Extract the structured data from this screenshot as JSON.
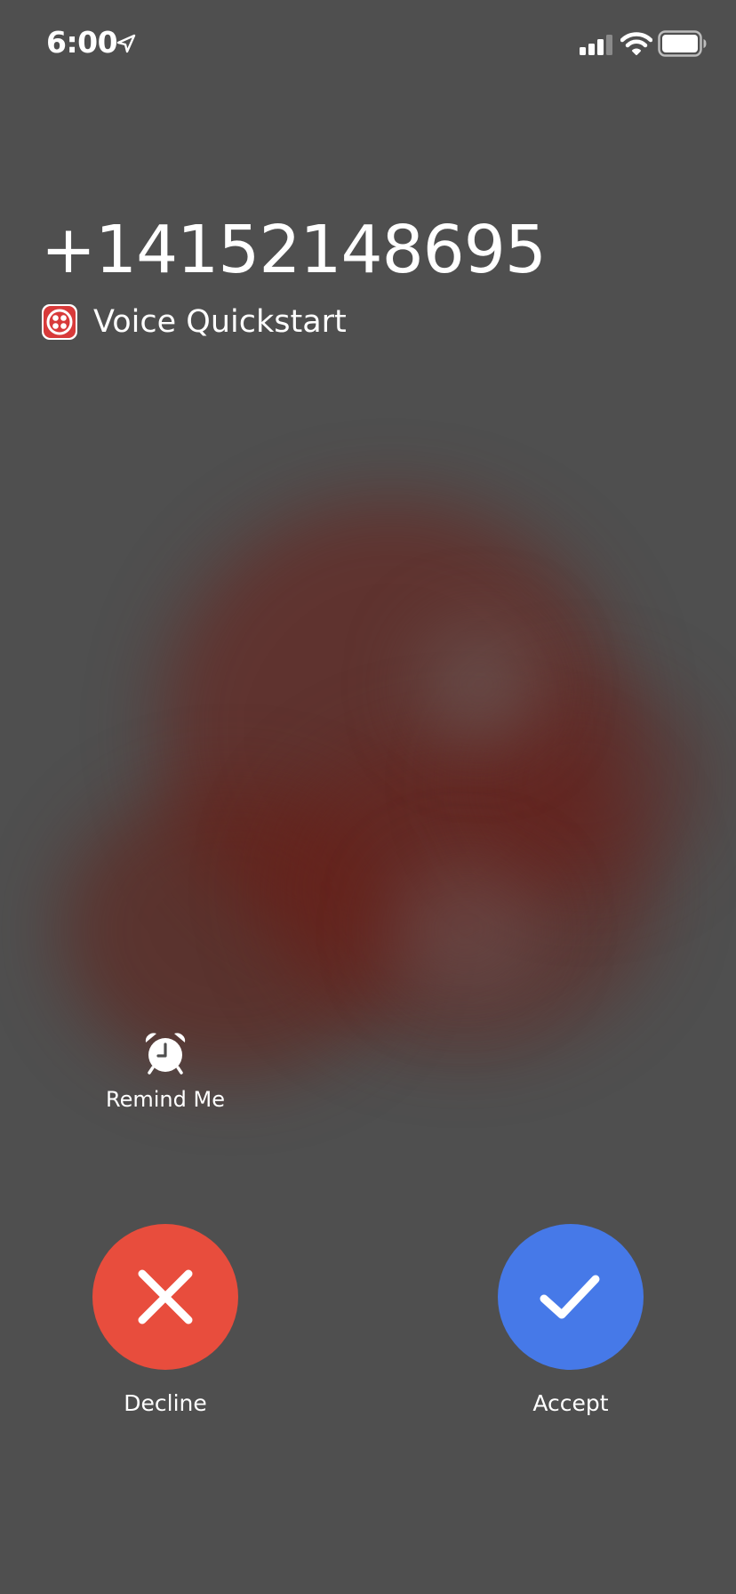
{
  "status_bar": {
    "time": "6:00",
    "icons": [
      "location-arrow-icon",
      "cellular-signal-icon",
      "wifi-icon",
      "battery-icon"
    ]
  },
  "caller": {
    "number": "+14152148695",
    "app_name": "Voice Quickstart",
    "app_icon": "twilio-logo-icon"
  },
  "remind": {
    "label": "Remind Me",
    "icon": "alarm-clock-icon"
  },
  "actions": {
    "decline": {
      "label": "Decline",
      "icon": "close-icon",
      "color": "#e84d3d"
    },
    "accept": {
      "label": "Accept",
      "icon": "checkmark-icon",
      "color": "#4679e8"
    }
  },
  "colors": {
    "background": "#4f4f4f",
    "app_icon_accent": "#d83a3a"
  }
}
